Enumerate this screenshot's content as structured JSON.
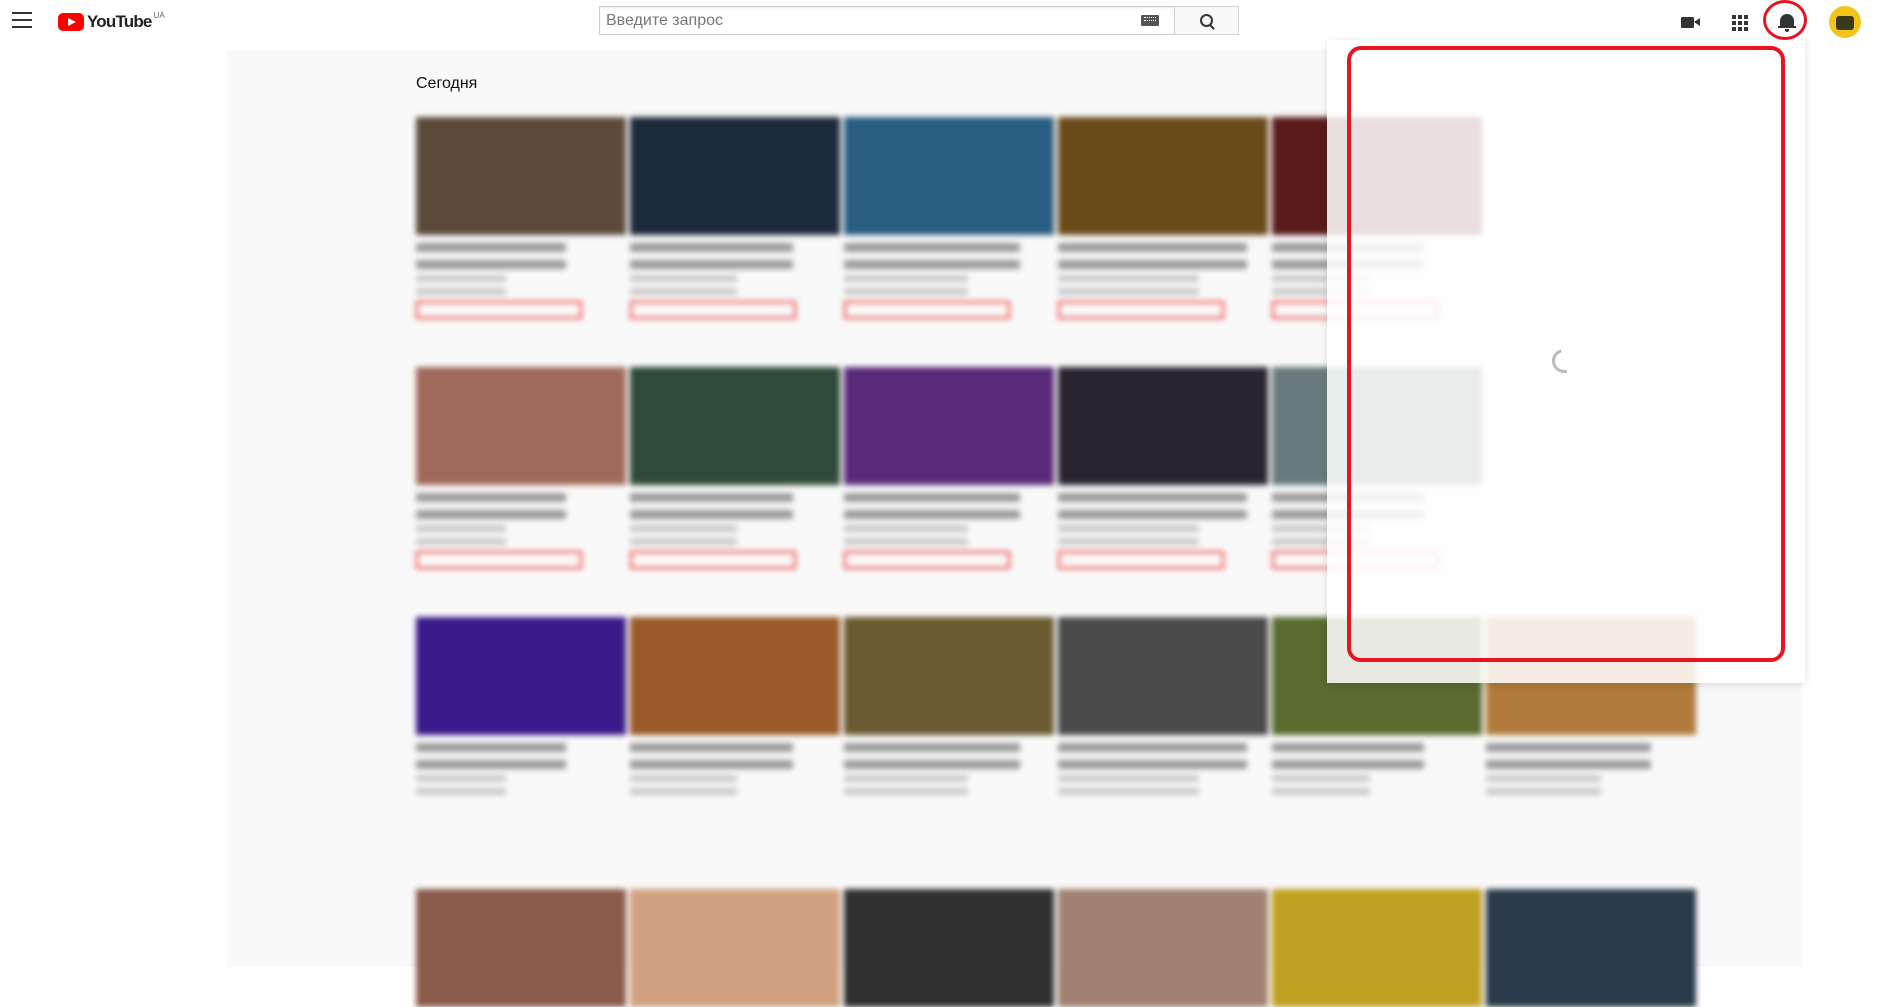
{
  "header": {
    "logo_text": "YouTube",
    "logo_region": "UA",
    "search_placeholder": "Введите запрос"
  },
  "main": {
    "section_title": "Сегодня"
  },
  "colors": {
    "brand_red": "#ff0000",
    "highlight_red": "#e8141f"
  },
  "icons": [
    "menu-icon",
    "youtube-logo",
    "keyboard-icon",
    "search-icon",
    "create-video-icon",
    "apps-icon",
    "notifications-bell-icon",
    "avatar"
  ],
  "videos": [
    {
      "color": "#5b4a3a"
    },
    {
      "color": "#1d2a3c"
    },
    {
      "color": "#2a5e80"
    },
    {
      "color": "#6a4a1a"
    },
    {
      "color": "#5a1a1a"
    },
    {
      "color": "#a06a5a"
    },
    {
      "color": "#2f4a3a"
    },
    {
      "color": "#5a2a7a"
    },
    {
      "color": "#2a2430"
    },
    {
      "color": "#6a7a7a"
    },
    {
      "color": "#3a1a8a"
    },
    {
      "color": "#9a5a2a"
    },
    {
      "color": "#6a5a30"
    },
    {
      "color": "#4a4a4a"
    },
    {
      "color": "#5a6a30"
    },
    {
      "color": "#b07a3a"
    },
    {
      "color": "#8a5a4a"
    },
    {
      "color": "#d0a080"
    },
    {
      "color": "#303030"
    },
    {
      "color": "#a08070"
    },
    {
      "color": "#c0a020"
    },
    {
      "color": "#2a3a4a"
    }
  ]
}
